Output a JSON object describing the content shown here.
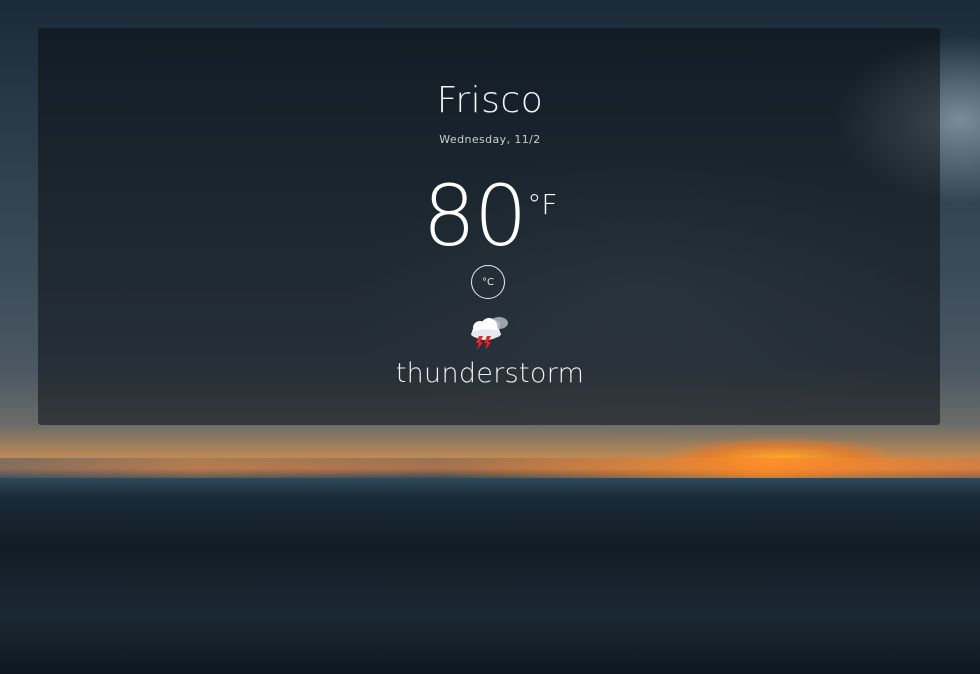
{
  "weather": {
    "city": "Frisco",
    "date": "Wednesday, 11/2",
    "temperature": "80",
    "unit": "°F",
    "toggle_unit_label": "°C",
    "condition": "thunderstorm",
    "condition_icon": "thunderstorm-icon"
  },
  "colors": {
    "panel_overlay": "rgba(10,14,20,0.55)",
    "text": "#ffffff",
    "bolt": "#e02a2a"
  }
}
